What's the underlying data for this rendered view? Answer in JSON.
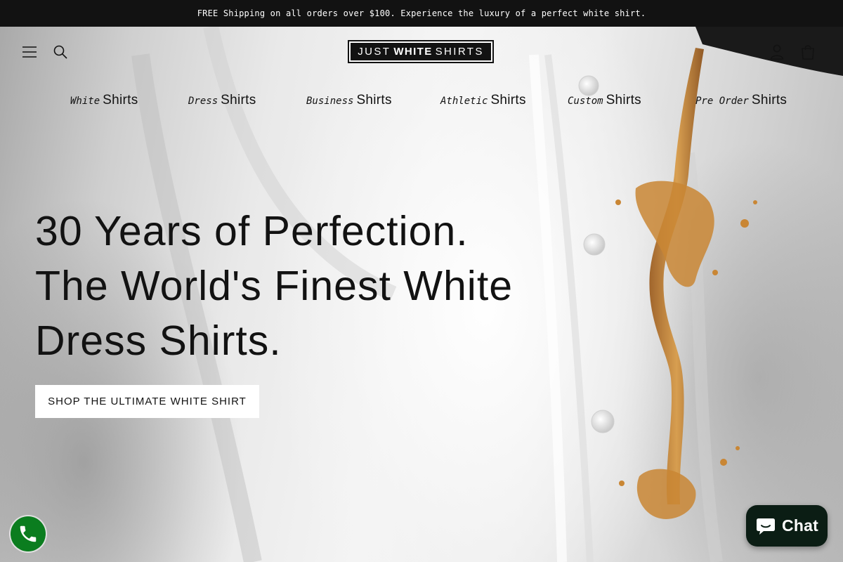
{
  "announcement": {
    "text": "FREE Shipping on all orders over $100. Experience the luxury of a perfect white shirt."
  },
  "header": {
    "menu_icon": "hamburger-icon",
    "search_icon": "search-icon",
    "account_icon": "user-icon",
    "cart_icon": "bag-icon",
    "logo": {
      "part1": "JUST",
      "part2": "WHITE",
      "part3": "SHIRTS"
    }
  },
  "categories": [
    {
      "prefix": "White",
      "label": "Shirts"
    },
    {
      "prefix": "Dress",
      "label": "Shirts"
    },
    {
      "prefix": "Business",
      "label": "Shirts"
    },
    {
      "prefix": "Athletic",
      "label": "Shirts"
    },
    {
      "prefix": "Custom",
      "label": "Shirts"
    },
    {
      "prefix": "Pre Order",
      "label": "Shirts"
    }
  ],
  "hero": {
    "headline": "30 Years of Perfection. The World's Finest White Dress Shirts.",
    "cta_label": "SHOP THE ULTIMATE WHITE SHIRT"
  },
  "widgets": {
    "call_icon": "phone-icon",
    "chat_label": "Chat",
    "chat_icon": "chat-bubble-icon"
  },
  "colors": {
    "text": "#121212",
    "announcement_bg": "#121212",
    "call_button": "#0b7d1f",
    "chat_button": "#0b1d14",
    "coffee": "#c07a2a"
  }
}
